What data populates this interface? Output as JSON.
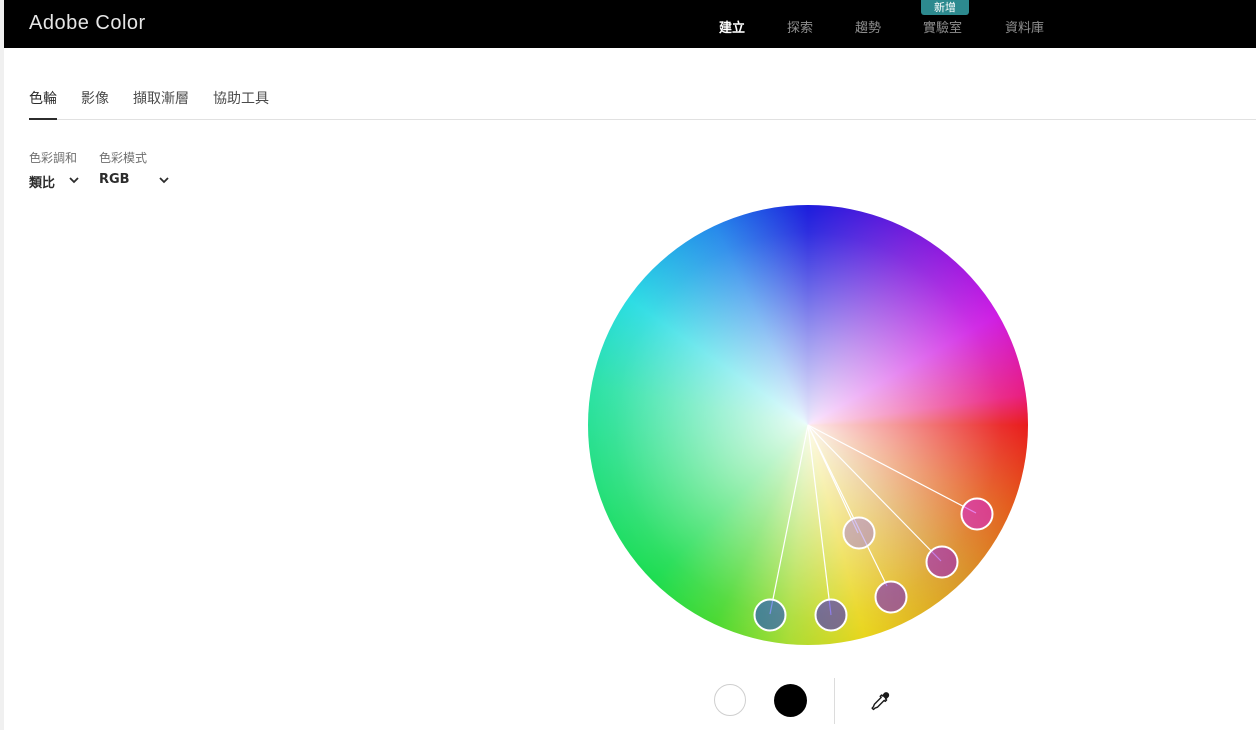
{
  "app": {
    "title": "Adobe Color"
  },
  "nav": {
    "items": [
      {
        "label": "建立",
        "active": true
      },
      {
        "label": "探索",
        "active": false
      },
      {
        "label": "趨勢",
        "active": false
      },
      {
        "label": "實驗室",
        "active": false
      },
      {
        "label": "資料庫",
        "active": false
      }
    ],
    "badge": "新增"
  },
  "tabs": [
    {
      "label": "色輪",
      "active": true
    },
    {
      "label": "影像",
      "active": false
    },
    {
      "label": "擷取漸層",
      "active": false
    },
    {
      "label": "協助工具",
      "active": false
    }
  ],
  "controls": {
    "harmony": {
      "label": "色彩調和",
      "value": "類比"
    },
    "mode": {
      "label": "色彩模式",
      "value": "RGB"
    }
  },
  "colors": {
    "topbar": "#000000",
    "badge": "#2d8a8f",
    "handle_stroke": "#ffffff"
  },
  "icons": {
    "harmony_dropdown": "chevron-down-icon",
    "mode_dropdown": "chevron-down-icon",
    "eyedropper": "eyedropper-icon"
  },
  "swatches": [
    {
      "name": "white",
      "color": "#ffffff"
    },
    {
      "name": "black",
      "color": "#000000"
    }
  ]
}
